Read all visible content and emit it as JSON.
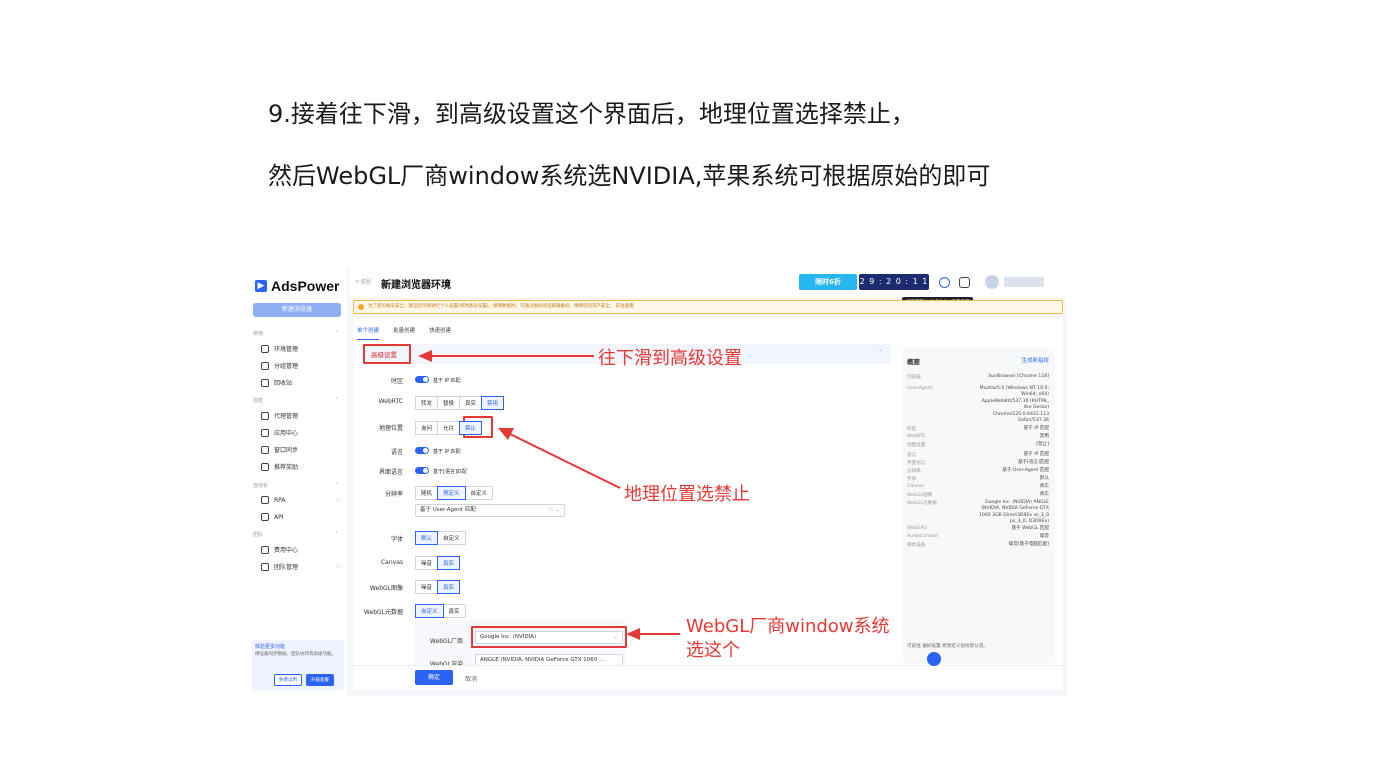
{
  "doc": {
    "line1": "9.接着往下滑，到高级设置这个界面后，地理位置选择禁止，",
    "line2": "然后WebGL厂商window系统选NVIDIA,苹果系统可根据原始的即可"
  },
  "app": {
    "brand": "AdsPower",
    "new_browser_label": "新建浏览器",
    "sidebar": {
      "groups": [
        {
          "label": "常用"
        },
        {
          "label": "加密"
        },
        {
          "label": "自动化"
        },
        {
          "label": "团队"
        }
      ],
      "items": [
        {
          "label": "环境管理"
        },
        {
          "label": "分组管理"
        },
        {
          "label": "回收站"
        },
        {
          "label": "代理管理"
        },
        {
          "label": "应用中心"
        },
        {
          "label": "窗口同步"
        },
        {
          "label": "推荐奖励"
        },
        {
          "label": "RPA"
        },
        {
          "label": "API"
        },
        {
          "label": "费用中心"
        },
        {
          "label": "团队管理"
        }
      ],
      "promo": {
        "title": "体验更多功能",
        "desc": "肆设备同步数据、团队协作等高级功能。",
        "trial_label": "免费试用",
        "upgrade_label": "升级套餐"
      }
    },
    "header": {
      "crumb": "< 返回",
      "title": "新建浏览器环境",
      "promo_tag": "限时6折",
      "countdown": "2 9 : 2 0 : 1 1",
      "update_tip": "发现新版本v2.7.2.9，查看更新"
    },
    "notice": "为了您的帐号安全，建议您尽快进行个人设置(修改备份设置)，保障数据时，可通过备份验证邮箱备份，保障您的资产安全。 前往查看",
    "tabs": [
      "单个创建",
      "批量创建",
      "快速创建"
    ],
    "section_title": "高级设置",
    "rows": {
      "timezone": {
        "label": "时区",
        "toggle_text": "基于 IP 匹配"
      },
      "webrtc": {
        "label": "WebRTC",
        "options": [
          "转发",
          "替换",
          "真实",
          "禁用"
        ]
      },
      "geo": {
        "label": "地理位置",
        "options": [
          "询问",
          "允许",
          "禁止"
        ]
      },
      "language": {
        "label": "语言",
        "toggle_text": "基于 IP 匹配"
      },
      "ui_lang": {
        "label": "界面语言",
        "toggle_text": "基于[语言]匹配"
      },
      "resolution": {
        "label": "分辨率",
        "options": [
          "随机",
          "预定义",
          "自定义"
        ],
        "select": "基于 User-Agent 匹配"
      },
      "font": {
        "label": "字体",
        "options": [
          "默认",
          "自定义"
        ]
      },
      "canvas": {
        "label": "Canvas",
        "options": [
          "噪音",
          "真实"
        ]
      },
      "webgl_img": {
        "label": "WebGL图像",
        "options": [
          "噪音",
          "真实"
        ]
      },
      "webgl_meta": {
        "label": "WebGL元数据",
        "options": [
          "自定义",
          "真实"
        ]
      },
      "webgl_vendor": {
        "label": "WebGL厂商",
        "value": "Google Inc. (NVIDIA)"
      },
      "webgl_render": {
        "label": "WebGL渲染",
        "value": "ANGLE (NVIDIA, NVIDIA GeForce GTX 1060 ..."
      }
    },
    "ok_label": "确定",
    "cancel_label": "取消",
    "summary": {
      "title": "概要",
      "generate_label": "生成新指纹",
      "rows": [
        {
          "k": "浏览器",
          "v": "SunBrowser [Chrome 118]"
        },
        {
          "k": "User-Agent",
          "v": "Mozilla/5.0 (Windows NT 10.0; Win64; x64) AppleWebKit/537.36 (KHTML, like Gecko) Chrome/125.0.6422.113 Safari/537.36"
        },
        {
          "k": "时区",
          "v": "基于 IP 匹配"
        },
        {
          "k": "WebRTC",
          "v": "禁用"
        },
        {
          "k": "地理位置",
          "v": "[禁止]"
        },
        {
          "k": "语言",
          "v": "基于 IP 匹配"
        },
        {
          "k": "界面语言",
          "v": "基于[语言]匹配"
        },
        {
          "k": "分辨率",
          "v": "基于 User-Agent 匹配"
        },
        {
          "k": "字体",
          "v": "默认"
        },
        {
          "k": "Canvas",
          "v": "真实"
        },
        {
          "k": "WebGL图像",
          "v": "真实"
        },
        {
          "k": "WebGL元数据",
          "v": "Google Inc. (NVIDIA) ANGLE (NVIDIA, NVIDIA GeForce GTX 1060 3GB Direct3D9Ex vs_3_0 ps_3_0, D3D9Ex)"
        },
        {
          "k": "WebGPU",
          "v": "基于 WebGL 匹配"
        },
        {
          "k": "AudioContext",
          "v": "噪音"
        },
        {
          "k": "媒体设备",
          "v": "噪音[基于电脑匹配]"
        }
      ],
      "foot": "可前往 偏好设置 修改定义指纹默认值。"
    }
  },
  "annotations": {
    "scroll_note": "往下滑到高级设置",
    "geo_note": "地理位置选禁止",
    "webgl_note_1": "WebGL厂商window系统",
    "webgl_note_2": "选这个"
  },
  "colors": {
    "accent": "#2b63f5",
    "annotation_red": "#e53935"
  }
}
